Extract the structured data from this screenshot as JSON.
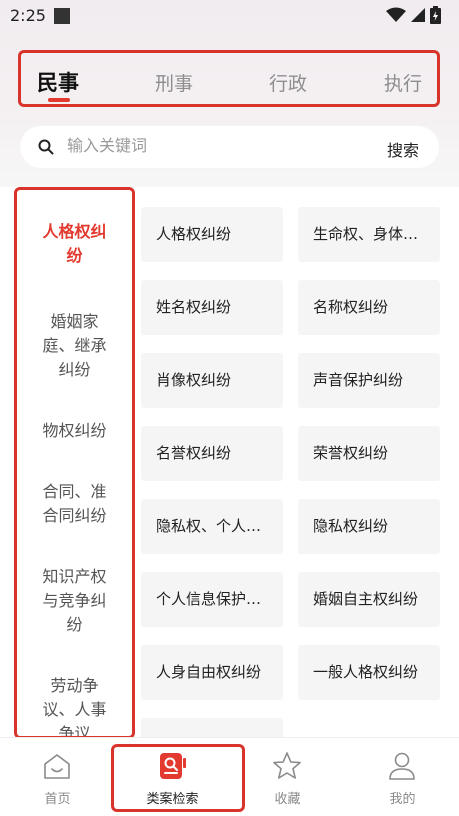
{
  "status": {
    "time": "2:25"
  },
  "tabs": [
    {
      "label": "民事",
      "active": true
    },
    {
      "label": "刑事",
      "active": false
    },
    {
      "label": "行政",
      "active": false
    },
    {
      "label": "执行",
      "active": false
    }
  ],
  "search": {
    "placeholder": "输入关键词",
    "button": "搜索"
  },
  "categories": [
    {
      "lines": [
        "人格权纠",
        "纷"
      ],
      "active": true
    },
    {
      "lines": [
        "婚姻家",
        "庭、继承",
        "纠纷"
      ],
      "active": false
    },
    {
      "lines": [
        "物权纠纷"
      ],
      "active": false
    },
    {
      "lines": [
        "合同、准",
        "合同纠纷"
      ],
      "active": false
    },
    {
      "lines": [
        "知识产权",
        "与竞争纠",
        "纷"
      ],
      "active": false
    },
    {
      "lines": [
        "劳动争",
        "议、人事",
        "争议"
      ],
      "active": false
    }
  ],
  "items": [
    "人格权纠纷",
    "生命权、身体…",
    "姓名权纠纷",
    "名称权纠纷",
    "肖像权纠纷",
    "声音保护纠纷",
    "名誉权纠纷",
    "荣誉权纠纷",
    "隐私权、个人…",
    "隐私权纠纷",
    "个人信息保护…",
    "婚姻自主权纠纷",
    "人身自由权纠纷",
    "一般人格权纠纷"
  ],
  "nav": [
    {
      "label": "首页",
      "icon": "home-icon"
    },
    {
      "label": "类案检索",
      "icon": "case-search-icon",
      "active": true
    },
    {
      "label": "收藏",
      "icon": "star-icon"
    },
    {
      "label": "我的",
      "icon": "person-icon"
    }
  ],
  "colors": {
    "accent": "#e23a2f",
    "highlight_border": "#d9342b"
  }
}
